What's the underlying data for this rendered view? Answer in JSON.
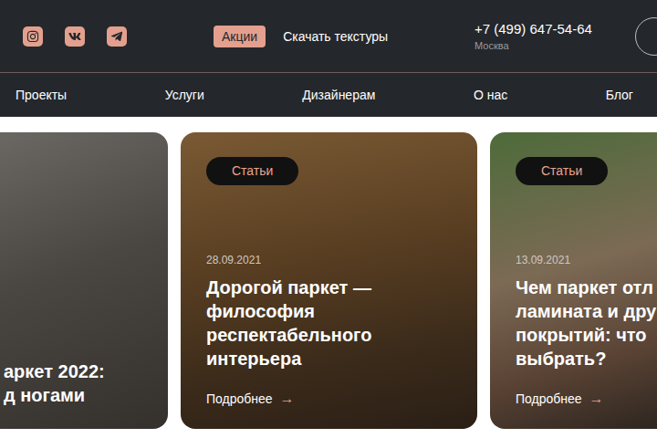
{
  "header": {
    "socials": [
      "instagram",
      "vk",
      "telegram"
    ],
    "promo": "Акции",
    "download": "Скачать текстуры",
    "phone": "+7 (499) 647-54-64",
    "city": "Москва"
  },
  "nav": {
    "items": [
      "Проекты",
      "Услуги",
      "Дизайнерам",
      "О нас",
      "Блог"
    ]
  },
  "cards": [
    {
      "position": "left-cut",
      "title": [
        "аркет 2022:",
        "д ногами"
      ]
    },
    {
      "position": "full",
      "badge": "Статьи",
      "date": "28.09.2021",
      "title": [
        "Дорогой паркет —",
        "философия",
        "респектабельного",
        "интерьера"
      ],
      "link": "Подробнее",
      "arrow": "→"
    },
    {
      "position": "right-cut",
      "badge": "Статьи",
      "date": "13.09.2021",
      "title": [
        "Чем паркет отл",
        "ламината и дру",
        "покрытий: что",
        "выбрать?"
      ],
      "link": "Подробнее",
      "arrow": "→"
    }
  ]
}
